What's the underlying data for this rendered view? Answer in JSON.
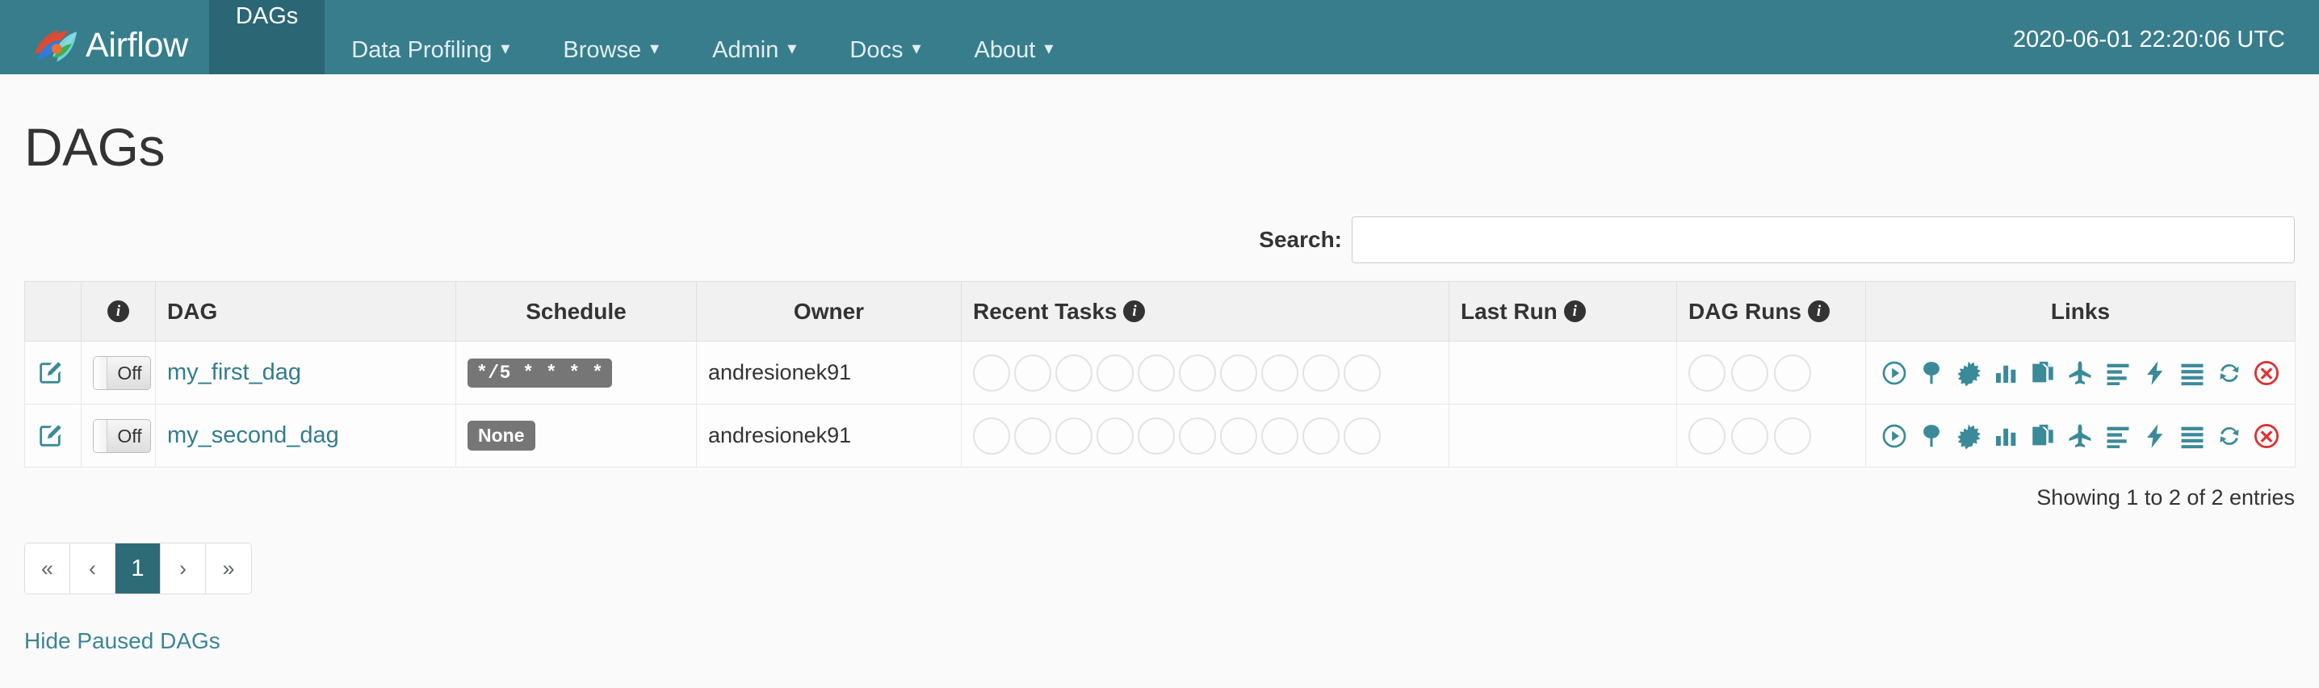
{
  "navbar": {
    "brand": "Airflow",
    "logo_icon": "airflow-pinwheel-logo",
    "items": [
      {
        "label": "DAGs",
        "has_caret": false,
        "active": true
      },
      {
        "label": "Data Profiling",
        "has_caret": true,
        "active": false
      },
      {
        "label": "Browse",
        "has_caret": true,
        "active": false
      },
      {
        "label": "Admin",
        "has_caret": true,
        "active": false
      },
      {
        "label": "Docs",
        "has_caret": true,
        "active": false
      },
      {
        "label": "About",
        "has_caret": true,
        "active": false
      }
    ],
    "clock": "2020-06-01 22:20:06 UTC",
    "bg_color": "#387d8c",
    "active_bg_color": "#2b6675"
  },
  "page": {
    "title": "DAGs"
  },
  "search": {
    "label": "Search:",
    "value": "",
    "placeholder": ""
  },
  "table": {
    "headers": {
      "blank": "",
      "info": "",
      "dag": "DAG",
      "schedule": "Schedule",
      "owner": "Owner",
      "recent_tasks": "Recent Tasks",
      "last_run": "Last Run",
      "dag_runs": "DAG Runs",
      "links": "Links"
    },
    "rows": [
      {
        "edit_icon": "edit-pencil-square-icon",
        "toggle_label": "Off",
        "toggle_state": "off",
        "dag_name": "my_first_dag",
        "schedule": "*/5 * * * *",
        "schedule_is_word": false,
        "owner": "andresionek91",
        "recent_tasks_count": 10,
        "last_run": "",
        "dag_runs_count": 3
      },
      {
        "edit_icon": "edit-pencil-square-icon",
        "toggle_label": "Off",
        "toggle_state": "off",
        "dag_name": "my_second_dag",
        "schedule": "None",
        "schedule_is_word": true,
        "owner": "andresionek91",
        "recent_tasks_count": 10,
        "last_run": "",
        "dag_runs_count": 3
      }
    ],
    "link_icons": [
      "trigger-dag-play-icon",
      "tree-view-icon",
      "graph-view-sun-icon",
      "task-duration-bar-chart-icon",
      "task-tries-copy-icon",
      "landing-times-plane-icon",
      "gantt-align-left-icon",
      "code-bolt-icon",
      "logs-list-icon",
      "refresh-icon",
      "delete-dag-circle-x-icon"
    ],
    "footer": "Showing 1 to 2 of 2 entries"
  },
  "pagination": {
    "items": [
      {
        "label": "«",
        "name": "first-page",
        "active": false
      },
      {
        "label": "‹",
        "name": "previous-page",
        "active": false
      },
      {
        "label": "1",
        "name": "page-1",
        "active": true
      },
      {
        "label": "›",
        "name": "next-page",
        "active": false
      },
      {
        "label": "»",
        "name": "last-page",
        "active": false
      }
    ]
  },
  "footer_link": {
    "label": "Hide Paused DAGs"
  },
  "colors": {
    "accent_teal": "#387d8c",
    "link_teal": "#337d8c",
    "badge_gray": "#767676",
    "delete_red": "#e03131"
  }
}
